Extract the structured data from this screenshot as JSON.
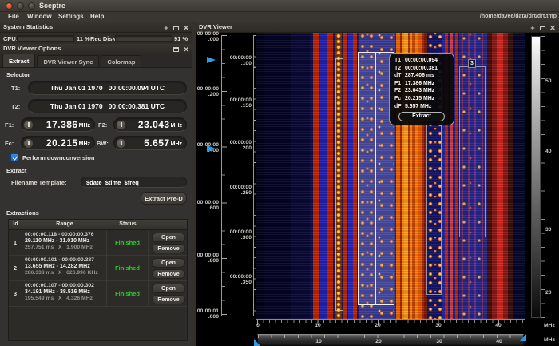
{
  "titlebar": {
    "title": "Sceptre"
  },
  "menubar": {
    "items": [
      "File",
      "Window",
      "Settings",
      "Help"
    ],
    "path": "/home/davee/data/drt/drt.tmp"
  },
  "icons": {
    "add": "+",
    "close": "✕"
  },
  "stats": {
    "title": "System Statistics",
    "cpu_label": "CPU:",
    "cpu_text": "11 %",
    "disk_label": "Rec Disk:",
    "disk_text": "91 %"
  },
  "options": {
    "title": "DVR Viewer Options",
    "tabs": {
      "extract": "Extract",
      "sync": "DVR Viewer Sync",
      "colormap": "Colormap"
    },
    "selector": {
      "label": "Selector",
      "t1_label": "T1:",
      "t1_value": "Thu Jan 01 1970   00:00:00.094 UTC",
      "t2_label": "T2:",
      "t2_value": "Thu Jan 01 1970   00:00:00.381 UTC",
      "f1_label": "F1:",
      "f1_value": "17.386",
      "f2_label": "F2:",
      "f2_value": "23.043",
      "fc_label": "Fc:",
      "fc_value": "20.215",
      "bw_label": "BW:",
      "bw_value": "5.657",
      "unit": "MHz",
      "downconv_label": "Perform downconversion"
    },
    "extract": {
      "label": "Extract",
      "filename_label": "Filename Template:",
      "filename_value": "$date_$time_$freq",
      "predec_button": "Extract Pre-D"
    },
    "extractions": {
      "label": "Extractions",
      "col_id": "Id",
      "col_range": "Range",
      "col_status": "Status",
      "open": "Open",
      "remove": "Remove",
      "rows": [
        {
          "id": "1",
          "time": "00:00:00.118 - 00:00:00.376",
          "freq": "29.110 MHz - 31.010 MHz",
          "size": "257.751 ms   X   1.900 MHz",
          "status": "Finished"
        },
        {
          "id": "2",
          "time": "00:00:00.101 - 00:00:00.387",
          "freq": "13.655 MHz - 14.282 MHz",
          "size": "286.338 ms   X   626.996 KHz",
          "status": "Finished"
        },
        {
          "id": "3",
          "time": "00:00:00.107 - 00:00:00.302",
          "freq": "34.191 MHz - 38.516 MHz",
          "size": "195.549 ms   X   4.326 MHz",
          "status": "Finished"
        }
      ]
    }
  },
  "viewer": {
    "title": "DVR Viewer",
    "tooltip": {
      "t1_k": "T1",
      "t1_v": "00:00:00.094",
      "t2_k": "T2",
      "t2_v": "00:00:00.381",
      "dt_k": "dT",
      "dt_v": "287.406 ms",
      "f1_k": "F1",
      "f1_v": "17.386 MHz",
      "f2_k": "F2",
      "f2_v": "23.043 MHz",
      "fc_k": "Fc",
      "fc_v": "20.215 MHz",
      "df_k": "dF",
      "df_v": "5.657 MHz",
      "button": "Extract"
    },
    "sel3_label": "3",
    "time_axis_full": [
      {
        "a": "00:00:00",
        "b": ".000"
      },
      {
        "a": "00:00:00",
        "b": ".200"
      },
      {
        "a": "00:00:00",
        "b": ".400"
      },
      {
        "a": "00:00:00",
        "b": ".600"
      },
      {
        "a": "00:00:00",
        "b": ".800"
      },
      {
        "a": "00:00:01",
        "b": ".000"
      }
    ],
    "time_axis_view": [
      {
        "a": "00:00:00",
        "b": ".100"
      },
      {
        "a": "00:00:00",
        "b": ".150"
      },
      {
        "a": "00:00:00",
        "b": ".200"
      },
      {
        "a": "00:00:00",
        "b": ".250"
      },
      {
        "a": "00:00:00",
        "b": ".300"
      },
      {
        "a": "00:00:00",
        "b": ".350"
      }
    ],
    "freq_axis_view": {
      "t0": "0",
      "t1": "10",
      "t2": "20",
      "t3": "30",
      "t4": "40",
      "unit": "MHz"
    },
    "freq_axis_full": {
      "t1": "10",
      "t2": "20",
      "t3": "30",
      "t4": "40",
      "unit": "MHz"
    },
    "colorbar": {
      "t50": "50",
      "t40": "40",
      "t30": "30",
      "t20": "20"
    }
  }
}
